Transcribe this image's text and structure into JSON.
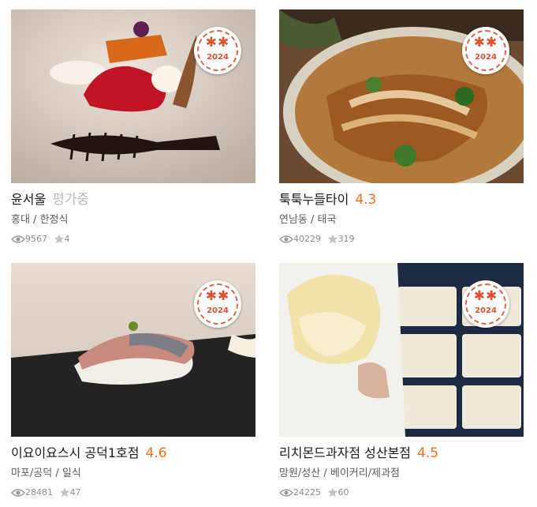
{
  "badge_colors": {
    "stroke": "#e0644a",
    "text": "#e0522f"
  },
  "score_color": "#f26e22",
  "restaurants": [
    {
      "name": "윤서울",
      "score": "평가중",
      "region": "홍대",
      "category": "한정식",
      "views": "9567",
      "reviews": "4",
      "badge": {
        "stars": "✱✱",
        "year": "2024"
      }
    },
    {
      "name": "툭툭누들타이",
      "score": "4.3",
      "region": "연남동",
      "category": "태국",
      "views": "40229",
      "reviews": "319",
      "badge": {
        "stars": "✱✱",
        "year": "2024"
      }
    },
    {
      "name": "이요이요스시 공덕1호점",
      "score": "4.6",
      "region": "마포/공덕",
      "category": "일식",
      "views": "28481",
      "reviews": "47",
      "badge": {
        "stars": "✱✱",
        "year": "2024"
      }
    },
    {
      "name": "리치몬드과자점 성산본점",
      "score": "4.5",
      "region": "망원/성산",
      "category": "베이커리/제과점",
      "views": "24225",
      "reviews": "60",
      "badge": {
        "stars": "✱✱",
        "year": "2024"
      }
    }
  ],
  "separator": " / ",
  "icons": {
    "views": "eye-icon",
    "reviews": "star-icon",
    "badge": "michelin-style-badge"
  }
}
